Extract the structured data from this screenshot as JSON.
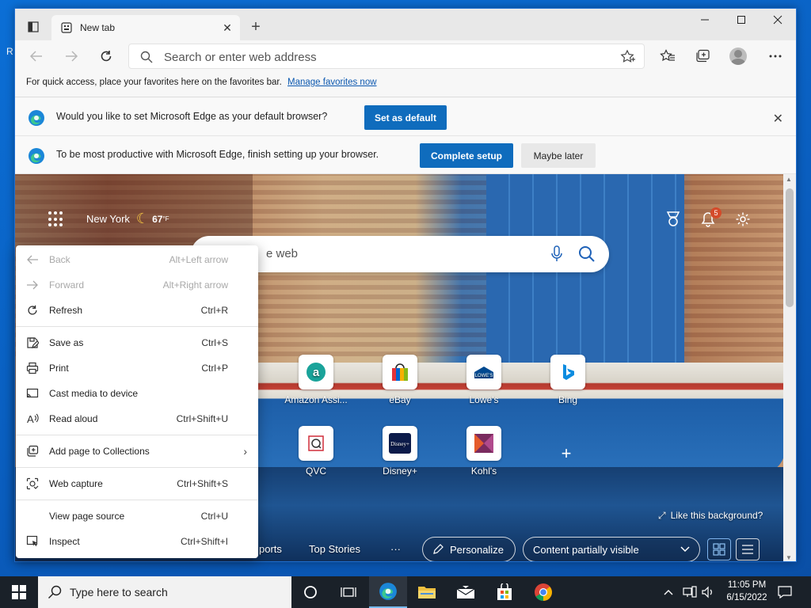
{
  "desktop": {
    "glyph": "R"
  },
  "browser": {
    "tab_title": "New tab",
    "address_placeholder": "Search or enter web address",
    "favorites_bar": {
      "text": "For quick access, place your favorites here on the favorites bar.",
      "link": "Manage favorites now"
    },
    "infobar_default": {
      "message": "Would you like to set Microsoft Edge as your default browser?",
      "button": "Set as default"
    },
    "infobar_setup": {
      "message": "To be most productive with Microsoft Edge, finish setting up your browser.",
      "primary": "Complete setup",
      "secondary": "Maybe later"
    }
  },
  "ntp": {
    "weather": {
      "city": "New York",
      "temp": "67",
      "unit": "°F"
    },
    "notifications_count": "5",
    "search_placeholder": "e web",
    "quick_links": [
      {
        "label": "Amazon Assi...",
        "icon": "amazon-icon",
        "color": "#1aa39a"
      },
      {
        "label": "eBay",
        "icon": "ebay-icon",
        "color": "#e53238"
      },
      {
        "label": "Lowe's",
        "icon": "lowes-icon",
        "color": "#004990"
      },
      {
        "label": "Bing",
        "icon": "bing-icon",
        "color": "#0c8ce0"
      },
      {
        "label": "QVC",
        "icon": "qvc-icon",
        "color": "#d02e3a"
      },
      {
        "label": "Disney+",
        "icon": "disney-plus-icon",
        "color": "#0c1b4a"
      },
      {
        "label": "Kohl's",
        "icon": "kohls-icon",
        "color": "#7a2b5f"
      }
    ],
    "like_background": "Like this background?",
    "nav": {
      "sports_partial": "ports",
      "top_stories": "Top Stories",
      "more": "···",
      "personalize": "Personalize",
      "content_visibility": "Content partially visible"
    }
  },
  "context_menu": {
    "items": [
      {
        "label": "Back",
        "shortcut": "Alt+Left arrow",
        "icon": "back-arrow-icon",
        "disabled": true
      },
      {
        "label": "Forward",
        "shortcut": "Alt+Right arrow",
        "icon": "forward-arrow-icon",
        "disabled": true
      },
      {
        "label": "Refresh",
        "shortcut": "Ctrl+R",
        "icon": "refresh-icon",
        "disabled": false
      },
      {
        "label": "Save as",
        "shortcut": "Ctrl+S",
        "icon": "save-as-icon",
        "disabled": false
      },
      {
        "label": "Print",
        "shortcut": "Ctrl+P",
        "icon": "print-icon",
        "disabled": false
      },
      {
        "label": "Cast media to device",
        "shortcut": "",
        "icon": "cast-icon",
        "disabled": false
      },
      {
        "label": "Read aloud",
        "shortcut": "Ctrl+Shift+U",
        "icon": "read-aloud-icon",
        "disabled": false
      },
      {
        "label": "Add page to Collections",
        "shortcut": "",
        "icon": "collections-icon",
        "disabled": false,
        "submenu": true
      },
      {
        "label": "Web capture",
        "shortcut": "Ctrl+Shift+S",
        "icon": "web-capture-icon",
        "disabled": false
      },
      {
        "label": "View page source",
        "shortcut": "Ctrl+U",
        "icon": "",
        "disabled": false
      },
      {
        "label": "Inspect",
        "shortcut": "Ctrl+Shift+I",
        "icon": "inspect-icon",
        "disabled": false
      }
    ]
  },
  "taskbar": {
    "search_placeholder": "Type here to search",
    "time": "11:05 PM",
    "date": "6/15/2022"
  },
  "colors": {
    "accent": "#0f6cbd",
    "taskbar": "#1a2129",
    "desktop": "#0a64c8"
  }
}
